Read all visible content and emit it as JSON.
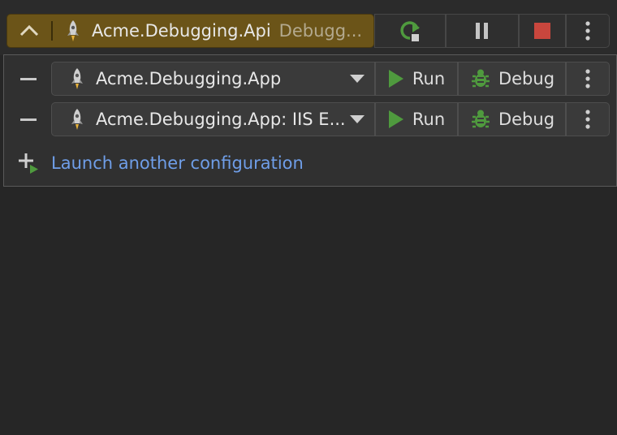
{
  "toolbar": {
    "active_config": {
      "name": "Acme.Debugging.Api",
      "status": "Debugg..."
    }
  },
  "configurations": [
    {
      "name": "Acme.Debugging.App",
      "run_label": "Run",
      "debug_label": "Debug"
    },
    {
      "name": "Acme.Debugging.App: IIS E...",
      "run_label": "Run",
      "debug_label": "Debug"
    }
  ],
  "launch_another": {
    "label": "Launch another configuration"
  },
  "colors": {
    "active_bg": "#6b5418",
    "accent_green": "#4f9a3e",
    "stop_red": "#c9463d",
    "link_blue": "#6f9ee8"
  },
  "icons": {
    "collapse": "chevron-up-icon",
    "config": "rocket-icon",
    "restart": "rerun-icon",
    "pause": "pause-icon",
    "stop": "stop-icon",
    "more": "more-vertical-icon",
    "remove": "minus-icon",
    "dropdown": "dropdown-arrow-icon",
    "run": "run-icon",
    "debug": "bug-icon",
    "add": "add-run-icon"
  }
}
